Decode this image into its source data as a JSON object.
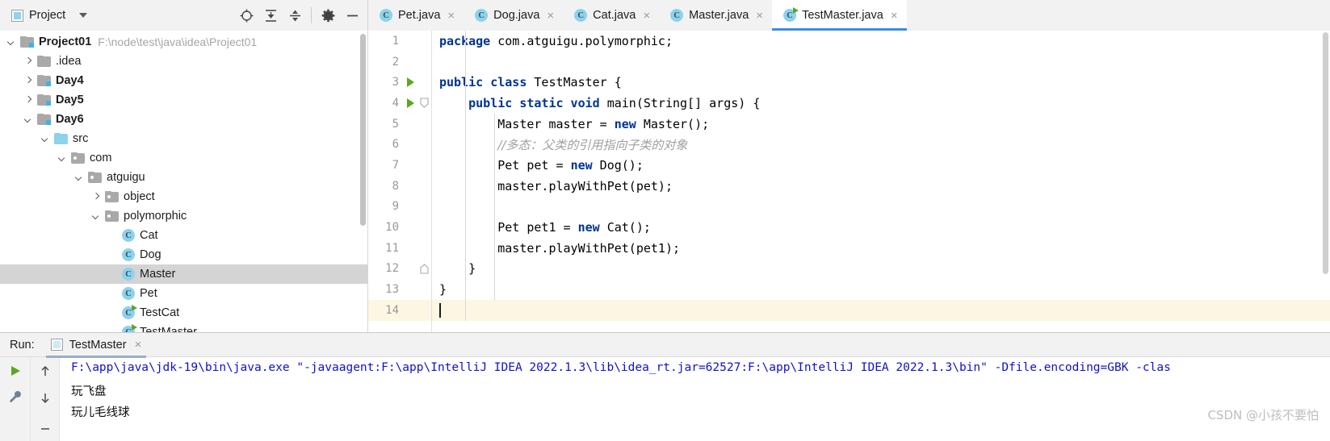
{
  "toolbar": {
    "project_label": "Project",
    "icons": [
      {
        "name": "locate-icon",
        "glyph": "locate"
      },
      {
        "name": "expand-all-icon",
        "glyph": "expand"
      },
      {
        "name": "collapse-all-icon",
        "glyph": "collapse"
      },
      {
        "name": "gear-icon",
        "glyph": "gear"
      },
      {
        "name": "hide-icon",
        "glyph": "minus"
      }
    ]
  },
  "tabs": [
    {
      "label": "Pet.java",
      "icon": "java-class-icon",
      "active": false,
      "runnable": false,
      "close": "×"
    },
    {
      "label": "Dog.java",
      "icon": "java-class-icon",
      "active": false,
      "runnable": false,
      "close": "×"
    },
    {
      "label": "Cat.java",
      "icon": "java-class-icon",
      "active": false,
      "runnable": false,
      "close": "×"
    },
    {
      "label": "Master.java",
      "icon": "java-class-icon",
      "active": false,
      "runnable": false,
      "close": "×"
    },
    {
      "label": "TestMaster.java",
      "icon": "java-runnable-class-icon",
      "active": true,
      "runnable": true,
      "close": "×"
    }
  ],
  "tree": [
    {
      "label": "Project01",
      "note": "F:\\node\\test\\java\\idea\\Project01",
      "indent": 0,
      "arrow": "down",
      "icon": "module-folder-icon",
      "bold": true,
      "selected": false
    },
    {
      "label": ".idea",
      "note": "",
      "indent": 1,
      "arrow": "right",
      "icon": "folder-icon",
      "bold": false,
      "selected": false
    },
    {
      "label": "Day4",
      "note": "",
      "indent": 1,
      "arrow": "right",
      "icon": "module-folder-icon",
      "bold": true,
      "selected": false
    },
    {
      "label": "Day5",
      "note": "",
      "indent": 1,
      "arrow": "right",
      "icon": "module-folder-icon",
      "bold": true,
      "selected": false
    },
    {
      "label": "Day6",
      "note": "",
      "indent": 1,
      "arrow": "down",
      "icon": "module-folder-icon",
      "bold": true,
      "selected": false
    },
    {
      "label": "src",
      "note": "",
      "indent": 2,
      "arrow": "down",
      "icon": "source-folder-icon",
      "bold": false,
      "selected": false
    },
    {
      "label": "com",
      "note": "",
      "indent": 3,
      "arrow": "down",
      "icon": "package-folder-icon",
      "bold": false,
      "selected": false
    },
    {
      "label": "atguigu",
      "note": "",
      "indent": 4,
      "arrow": "down",
      "icon": "package-folder-icon",
      "bold": false,
      "selected": false
    },
    {
      "label": "object",
      "note": "",
      "indent": 5,
      "arrow": "right",
      "icon": "package-folder-icon",
      "bold": false,
      "selected": false
    },
    {
      "label": "polymorphic",
      "note": "",
      "indent": 5,
      "arrow": "down",
      "icon": "package-folder-icon",
      "bold": false,
      "selected": false
    },
    {
      "label": "Cat",
      "note": "",
      "indent": 6,
      "arrow": "none",
      "icon": "java-class-icon",
      "bold": false,
      "selected": false
    },
    {
      "label": "Dog",
      "note": "",
      "indent": 6,
      "arrow": "none",
      "icon": "java-class-icon",
      "bold": false,
      "selected": false
    },
    {
      "label": "Master",
      "note": "",
      "indent": 6,
      "arrow": "none",
      "icon": "java-class-icon",
      "bold": false,
      "selected": true
    },
    {
      "label": "Pet",
      "note": "",
      "indent": 6,
      "arrow": "none",
      "icon": "java-class-icon",
      "bold": false,
      "selected": false
    },
    {
      "label": "TestCat",
      "note": "",
      "indent": 6,
      "arrow": "none",
      "icon": "java-runnable-class-icon",
      "bold": false,
      "selected": false
    },
    {
      "label": "TestMaster",
      "note": "",
      "indent": 6,
      "arrow": "none",
      "icon": "java-runnable-class-icon",
      "bold": false,
      "selected": false
    }
  ],
  "editor": {
    "lines": [
      {
        "num": "1",
        "run": false,
        "fold": "",
        "current": false,
        "tokens": [
          {
            "t": "package",
            "k": "kw"
          },
          {
            "t": " com.atguigu.polymorphic;",
            "k": ""
          }
        ],
        "indent": 0
      },
      {
        "num": "2",
        "run": false,
        "fold": "",
        "current": false,
        "tokens": [],
        "indent": 0
      },
      {
        "num": "3",
        "run": true,
        "fold": "",
        "current": false,
        "tokens": [
          {
            "t": "public class",
            "k": "kw"
          },
          {
            "t": " TestMaster {",
            "k": ""
          }
        ],
        "indent": 0
      },
      {
        "num": "4",
        "run": true,
        "fold": "open",
        "current": false,
        "tokens": [
          {
            "t": "    ",
            "k": ""
          },
          {
            "t": "public static void",
            "k": "kw"
          },
          {
            "t": " main(String[] args) {",
            "k": ""
          }
        ],
        "indent": 1
      },
      {
        "num": "5",
        "run": false,
        "fold": "",
        "current": false,
        "tokens": [
          {
            "t": "        Master master = ",
            "k": ""
          },
          {
            "t": "new",
            "k": "kw"
          },
          {
            "t": " Master();",
            "k": ""
          }
        ],
        "indent": 2
      },
      {
        "num": "6",
        "run": false,
        "fold": "",
        "current": false,
        "tokens": [
          {
            "t": "        ",
            "k": ""
          },
          {
            "t": "//多态：父类的引用指向子类的对象",
            "k": "cmt"
          }
        ],
        "indent": 2
      },
      {
        "num": "7",
        "run": false,
        "fold": "",
        "current": false,
        "tokens": [
          {
            "t": "        Pet pet = ",
            "k": ""
          },
          {
            "t": "new",
            "k": "kw"
          },
          {
            "t": " Dog();",
            "k": ""
          }
        ],
        "indent": 2
      },
      {
        "num": "8",
        "run": false,
        "fold": "",
        "current": false,
        "tokens": [
          {
            "t": "        master.playWithPet(pet);",
            "k": ""
          }
        ],
        "indent": 2
      },
      {
        "num": "9",
        "run": false,
        "fold": "",
        "current": false,
        "tokens": [],
        "indent": 2
      },
      {
        "num": "10",
        "run": false,
        "fold": "",
        "current": false,
        "tokens": [
          {
            "t": "        Pet pet1 = ",
            "k": ""
          },
          {
            "t": "new",
            "k": "kw"
          },
          {
            "t": " Cat();",
            "k": ""
          }
        ],
        "indent": 2
      },
      {
        "num": "11",
        "run": false,
        "fold": "",
        "current": false,
        "tokens": [
          {
            "t": "        master.playWithPet(pet1);",
            "k": ""
          }
        ],
        "indent": 2
      },
      {
        "num": "12",
        "run": false,
        "fold": "close",
        "current": false,
        "tokens": [
          {
            "t": "    }",
            "k": ""
          }
        ],
        "indent": 1
      },
      {
        "num": "13",
        "run": false,
        "fold": "",
        "current": false,
        "tokens": [
          {
            "t": "}",
            "k": ""
          }
        ],
        "indent": 0
      },
      {
        "num": "14",
        "run": false,
        "fold": "",
        "current": true,
        "tokens": [],
        "indent": 0
      }
    ]
  },
  "run_panel": {
    "label": "Run:",
    "tab_label": "TestMaster",
    "tab_close": "×",
    "side_buttons": [
      {
        "name": "rerun-button",
        "glyph": "play"
      },
      {
        "name": "settings-wrench-button",
        "glyph": "wrench"
      },
      {
        "name": "scroll-up-button",
        "glyph": "up"
      },
      {
        "name": "scroll-down-button",
        "glyph": "down"
      },
      {
        "name": "soft-wrap-button",
        "glyph": "wrap"
      }
    ],
    "console_lines": [
      {
        "text": "F:\\app\\java\\jdk-19\\bin\\java.exe \"-javaagent:F:\\app\\IntelliJ IDEA 2022.1.3\\lib\\idea_rt.jar=62527:F:\\app\\IntelliJ IDEA 2022.1.3\\bin\" -Dfile.encoding=GBK -clas",
        "kind": "cmd"
      },
      {
        "text": "玩飞盘",
        "kind": "cn"
      },
      {
        "text": "玩儿毛线球",
        "kind": "cn"
      }
    ]
  },
  "watermark": "CSDN @小孩不要怕",
  "colors": {
    "accent": "#3b8ee0",
    "keyword": "#00348f",
    "console_cmd": "#1111cc",
    "selection": "#d4d4d4",
    "current_line": "#fdf6e3",
    "run_green": "#59a81f"
  }
}
